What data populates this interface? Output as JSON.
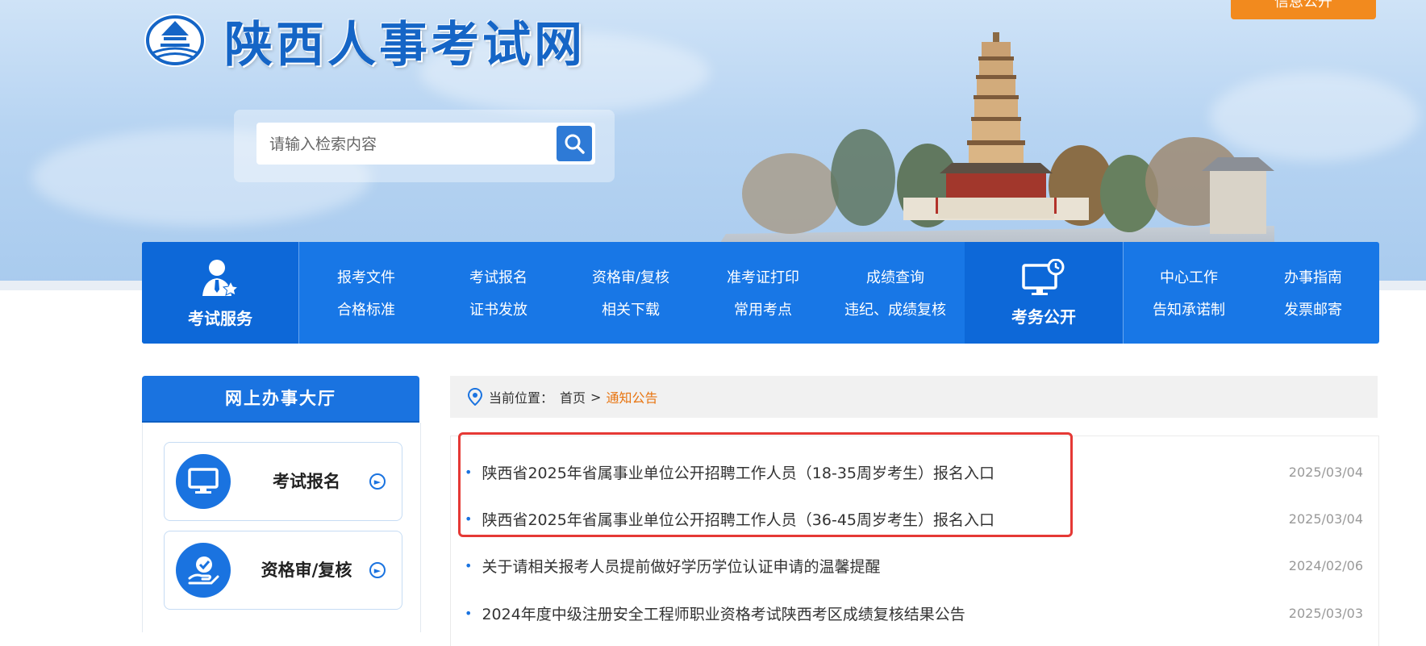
{
  "site": {
    "name": "陕西人事考试网"
  },
  "header": {
    "top_button": "信息公开"
  },
  "search": {
    "placeholder": "请输入检索内容"
  },
  "nav": {
    "exam_service": "考试服务",
    "col1": [
      "报考文件",
      "合格标准"
    ],
    "col2": [
      "考试报名",
      "证书发放"
    ],
    "col3": [
      "资格审/复核",
      "相关下载"
    ],
    "col4": [
      "准考证打印",
      "常用考点"
    ],
    "col5": [
      "成绩查询",
      "违纪、成绩复核"
    ],
    "exam_public": "考务公开",
    "col6": [
      "中心工作",
      "告知承诺制"
    ],
    "col7": [
      "办事指南",
      "发票邮寄"
    ]
  },
  "sidebar": {
    "title": "网上办事大厅",
    "items": [
      {
        "label": "考试报名",
        "icon": "monitor-icon"
      },
      {
        "label": "资格审/复核",
        "icon": "hand-check-icon"
      }
    ]
  },
  "breadcrumb": {
    "prefix": "当前位置：",
    "home": "首页",
    "sep": ">",
    "current": "通知公告"
  },
  "news": [
    {
      "title": "陕西省2025年省属事业单位公开招聘工作人员（18-35周岁考生）报名入口",
      "date": "2025/03/04"
    },
    {
      "title": "陕西省2025年省属事业单位公开招聘工作人员（36-45周岁考生）报名入口",
      "date": "2025/03/04"
    },
    {
      "title": "关于请相关报考人员提前做好学历学位认证申请的温馨提醒",
      "date": "2024/02/06"
    },
    {
      "title": "2024年度中级注册安全工程师职业资格考试陕西考区成绩复核结果公告",
      "date": "2025/03/03"
    }
  ],
  "colors": {
    "primary": "#1877e6",
    "accent": "#e8740f",
    "highlight": "#e53935"
  }
}
